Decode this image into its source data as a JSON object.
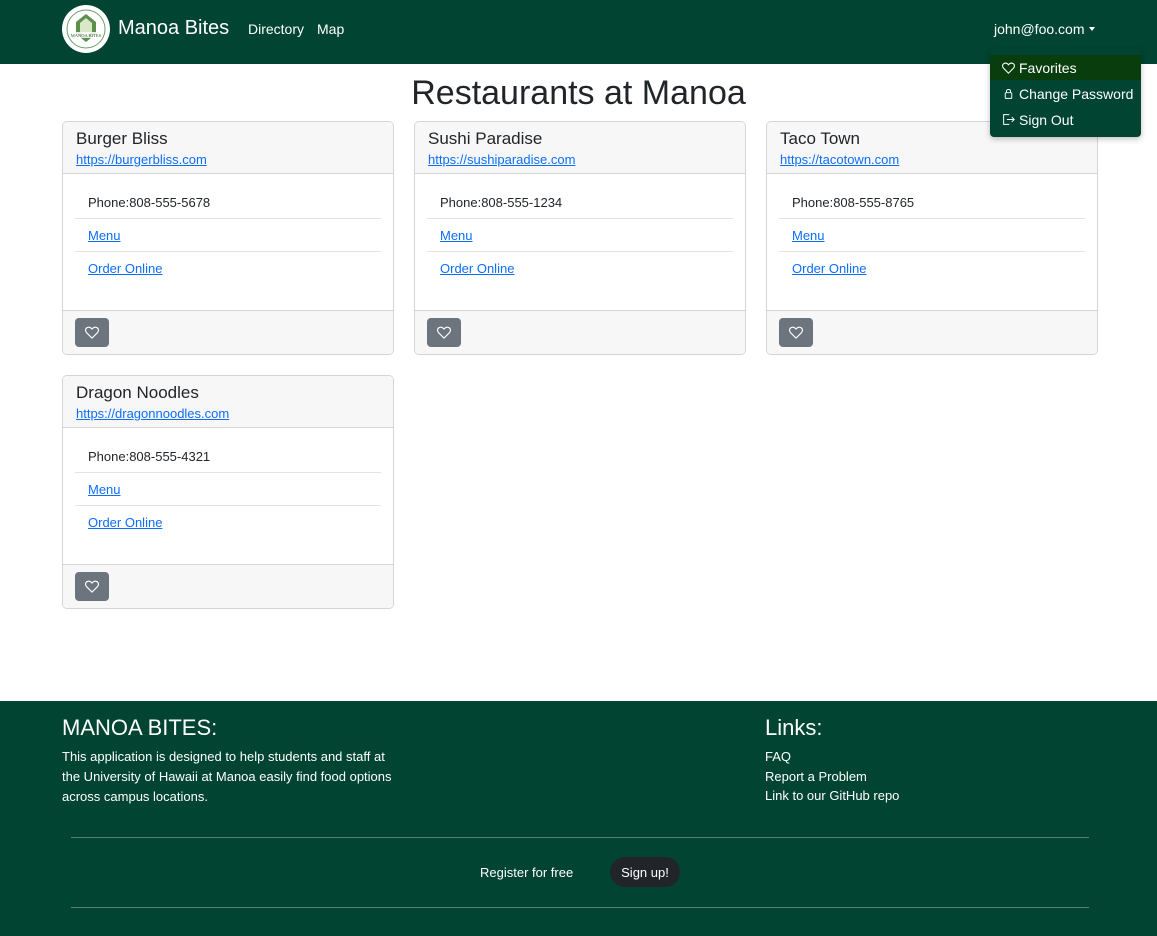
{
  "navbar": {
    "brand": "Manoa Bites",
    "logo_text": "MANOA BITES",
    "links": [
      "Directory",
      "Map"
    ],
    "user_email": "john@foo.com",
    "bg_color": "#004431"
  },
  "user_menu": {
    "items": [
      {
        "label": "Favorites",
        "icon": "heart-icon",
        "active": true
      },
      {
        "label": "Change Password",
        "icon": "lock-icon",
        "active": false
      },
      {
        "label": "Sign Out",
        "icon": "sign-out-icon",
        "active": false
      }
    ]
  },
  "main": {
    "title": "Restaurants at Manoa",
    "phone_prefix": "Phone:",
    "menu_label": "Menu",
    "order_label": "Order Online",
    "restaurants": [
      {
        "name": "Burger Bliss",
        "url": "https://burgerbliss.com",
        "phone": "808-555-5678"
      },
      {
        "name": "Sushi Paradise",
        "url": "https://sushiparadise.com",
        "phone": "808-555-1234"
      },
      {
        "name": "Taco Town",
        "url": "https://tacotown.com",
        "phone": "808-555-8765"
      },
      {
        "name": "Dragon Noodles",
        "url": "https://dragonnoodles.com",
        "phone": "808-555-4321"
      }
    ]
  },
  "footer": {
    "about_heading": "MANOA BITES:",
    "about_text": "This application is designed to help students and staff at the University of Hawaii at Manoa easily find food options across campus locations.",
    "links_heading": "Links:",
    "links": [
      "FAQ",
      "Report a Problem",
      "Link to our GitHub repo"
    ],
    "register_text": "Register for free",
    "signup_label": "Sign up!"
  }
}
